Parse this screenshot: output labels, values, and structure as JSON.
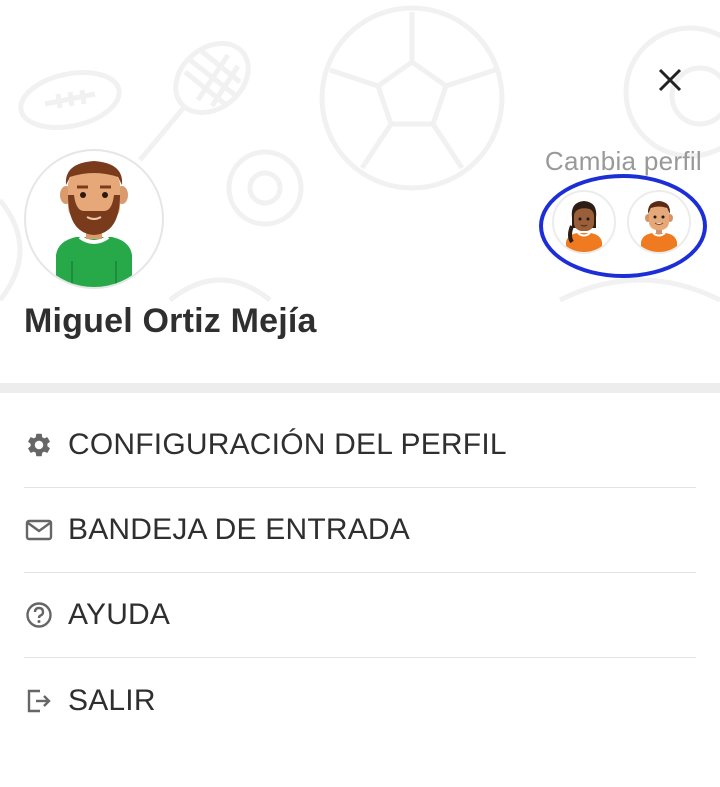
{
  "profile": {
    "name": "Miguel Ortiz Mejía",
    "avatar_icon": "bearded-man-avatar-icon"
  },
  "switcher": {
    "label": "Cambia perfil",
    "highlight_color": "#1c2fd6",
    "profiles": [
      {
        "icon": "girl-avatar-icon"
      },
      {
        "icon": "boy-avatar-icon"
      }
    ]
  },
  "header": {
    "close_icon": "close-icon"
  },
  "menu": {
    "items": [
      {
        "label": "CONFIGURACIÓN DEL PERFIL",
        "icon": "gear-icon"
      },
      {
        "label": "BANDEJA DE ENTRADA",
        "icon": "mail-icon"
      },
      {
        "label": "AYUDA",
        "icon": "help-circle-icon"
      },
      {
        "label": "SALIR",
        "icon": "logout-icon"
      }
    ]
  }
}
